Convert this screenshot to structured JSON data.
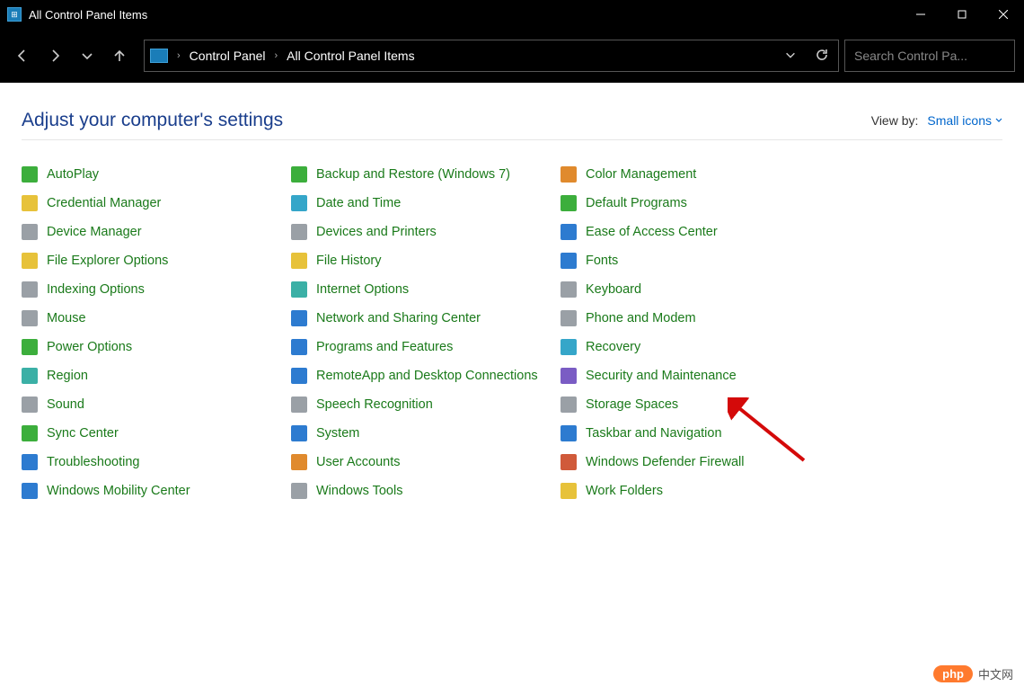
{
  "window": {
    "title": "All Control Panel Items"
  },
  "address": {
    "crumb1": "Control Panel",
    "crumb2": "All Control Panel Items"
  },
  "search": {
    "placeholder": "Search Control Pa..."
  },
  "page": {
    "heading": "Adjust your computer's settings",
    "viewby_label": "View by:",
    "viewby_value": "Small icons"
  },
  "items": {
    "col0": [
      {
        "label": "AutoPlay",
        "icon": "autoplay",
        "tint": "c-green"
      },
      {
        "label": "Credential Manager",
        "icon": "credential",
        "tint": "c-yellow"
      },
      {
        "label": "Device Manager",
        "icon": "device",
        "tint": "c-gray"
      },
      {
        "label": "File Explorer Options",
        "icon": "folder-options",
        "tint": "c-yellow"
      },
      {
        "label": "Indexing Options",
        "icon": "indexing",
        "tint": "c-gray"
      },
      {
        "label": "Mouse",
        "icon": "mouse",
        "tint": "c-gray"
      },
      {
        "label": "Power Options",
        "icon": "power",
        "tint": "c-green"
      },
      {
        "label": "Region",
        "icon": "region",
        "tint": "c-teal"
      },
      {
        "label": "Sound",
        "icon": "sound",
        "tint": "c-gray"
      },
      {
        "label": "Sync Center",
        "icon": "sync",
        "tint": "c-green"
      },
      {
        "label": "Troubleshooting",
        "icon": "troubleshoot",
        "tint": "c-blue"
      },
      {
        "label": "Windows Mobility Center",
        "icon": "mobility",
        "tint": "c-blue"
      }
    ],
    "col1": [
      {
        "label": "Backup and Restore (Windows 7)",
        "icon": "backup",
        "tint": "c-green"
      },
      {
        "label": "Date and Time",
        "icon": "datetime",
        "tint": "c-cyan"
      },
      {
        "label": "Devices and Printers",
        "icon": "printers",
        "tint": "c-gray"
      },
      {
        "label": "File History",
        "icon": "filehistory",
        "tint": "c-yellow"
      },
      {
        "label": "Internet Options",
        "icon": "internet",
        "tint": "c-teal"
      },
      {
        "label": "Network and Sharing Center",
        "icon": "network",
        "tint": "c-blue"
      },
      {
        "label": "Programs and Features",
        "icon": "programs",
        "tint": "c-blue"
      },
      {
        "label": "RemoteApp and Desktop Connections",
        "icon": "remoteapp",
        "tint": "c-blue"
      },
      {
        "label": "Speech Recognition",
        "icon": "speech",
        "tint": "c-gray"
      },
      {
        "label": "System",
        "icon": "system",
        "tint": "c-blue"
      },
      {
        "label": "User Accounts",
        "icon": "users",
        "tint": "c-orange"
      },
      {
        "label": "Windows Tools",
        "icon": "tools",
        "tint": "c-gray"
      }
    ],
    "col2": [
      {
        "label": "Color Management",
        "icon": "color",
        "tint": "c-orange"
      },
      {
        "label": "Default Programs",
        "icon": "defaults",
        "tint": "c-green"
      },
      {
        "label": "Ease of Access Center",
        "icon": "ease",
        "tint": "c-blue"
      },
      {
        "label": "Fonts",
        "icon": "fonts",
        "tint": "c-blue"
      },
      {
        "label": "Keyboard",
        "icon": "keyboard",
        "tint": "c-gray"
      },
      {
        "label": "Phone and Modem",
        "icon": "phone",
        "tint": "c-gray"
      },
      {
        "label": "Recovery",
        "icon": "recovery",
        "tint": "c-cyan"
      },
      {
        "label": "Security and Maintenance",
        "icon": "security",
        "tint": "c-purple"
      },
      {
        "label": "Storage Spaces",
        "icon": "storage",
        "tint": "c-gray"
      },
      {
        "label": "Taskbar and Navigation",
        "icon": "taskbar",
        "tint": "c-blue"
      },
      {
        "label": "Windows Defender Firewall",
        "icon": "firewall",
        "tint": "c-red"
      },
      {
        "label": "Work Folders",
        "icon": "workfolders",
        "tint": "c-yellow"
      }
    ]
  },
  "watermark": {
    "pill": "php",
    "text": "中文网"
  }
}
